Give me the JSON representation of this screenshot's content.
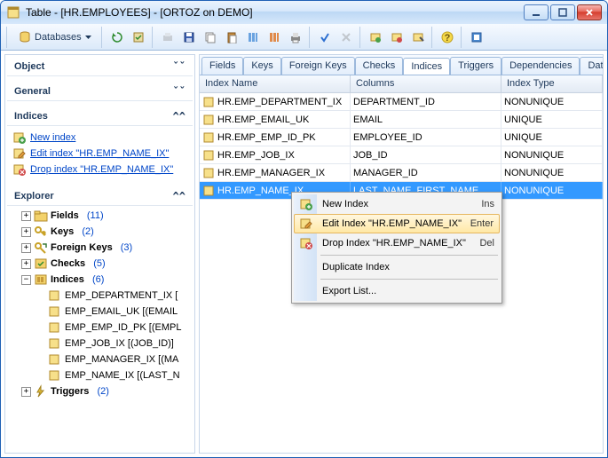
{
  "window": {
    "title": "Table - [HR.EMPLOYEES] - [ORTOZ on DEMO]"
  },
  "toolbar": {
    "databases": "Databases"
  },
  "sections": {
    "object": "Object",
    "general": "General",
    "indices": "Indices",
    "explorer": "Explorer"
  },
  "actions": {
    "new_index": "New index",
    "edit_index": "Edit index \"HR.EMP_NAME_IX\"",
    "drop_index": "Drop index \"HR.EMP_NAME_IX\""
  },
  "tree": {
    "fields": {
      "label": "Fields",
      "count": "(11)"
    },
    "keys": {
      "label": "Keys",
      "count": "(2)"
    },
    "fkeys": {
      "label": "Foreign Keys",
      "count": "(3)"
    },
    "checks": {
      "label": "Checks",
      "count": "(5)"
    },
    "indices": {
      "label": "Indices",
      "count": "(6)",
      "items": [
        "EMP_DEPARTMENT_IX [",
        "EMP_EMAIL_UK [(EMAIL",
        "EMP_EMP_ID_PK [(EMPL",
        "EMP_JOB_IX [(JOB_ID)]",
        "EMP_MANAGER_IX [(MA",
        "EMP_NAME_IX [(LAST_N"
      ]
    },
    "triggers": {
      "label": "Triggers",
      "count": "(2)"
    }
  },
  "tabs": [
    "Fields",
    "Keys",
    "Foreign Keys",
    "Checks",
    "Indices",
    "Triggers",
    "Dependencies",
    "Dat"
  ],
  "grid": {
    "headers": {
      "name": "Index Name",
      "columns": "Columns",
      "type": "Index Type"
    },
    "rows": [
      {
        "name": "HR.EMP_DEPARTMENT_IX",
        "columns": "DEPARTMENT_ID",
        "type": "NONUNIQUE"
      },
      {
        "name": "HR.EMP_EMAIL_UK",
        "columns": "EMAIL",
        "type": "UNIQUE"
      },
      {
        "name": "HR.EMP_EMP_ID_PK",
        "columns": "EMPLOYEE_ID",
        "type": "UNIQUE"
      },
      {
        "name": "HR.EMP_JOB_IX",
        "columns": "JOB_ID",
        "type": "NONUNIQUE"
      },
      {
        "name": "HR.EMP_MANAGER_IX",
        "columns": "MANAGER_ID",
        "type": "NONUNIQUE"
      },
      {
        "name": "HR.EMP_NAME_IX",
        "columns": "LAST_NAME, FIRST_NAME",
        "type": "NONUNIQUE"
      }
    ]
  },
  "context_menu": {
    "new": {
      "label": "New Index",
      "shortcut": "Ins"
    },
    "edit": {
      "label": "Edit Index \"HR.EMP_NAME_IX\"",
      "shortcut": "Enter"
    },
    "drop": {
      "label": "Drop Index \"HR.EMP_NAME_IX\"",
      "shortcut": "Del"
    },
    "duplicate": {
      "label": "Duplicate Index"
    },
    "export": {
      "label": "Export List..."
    }
  }
}
